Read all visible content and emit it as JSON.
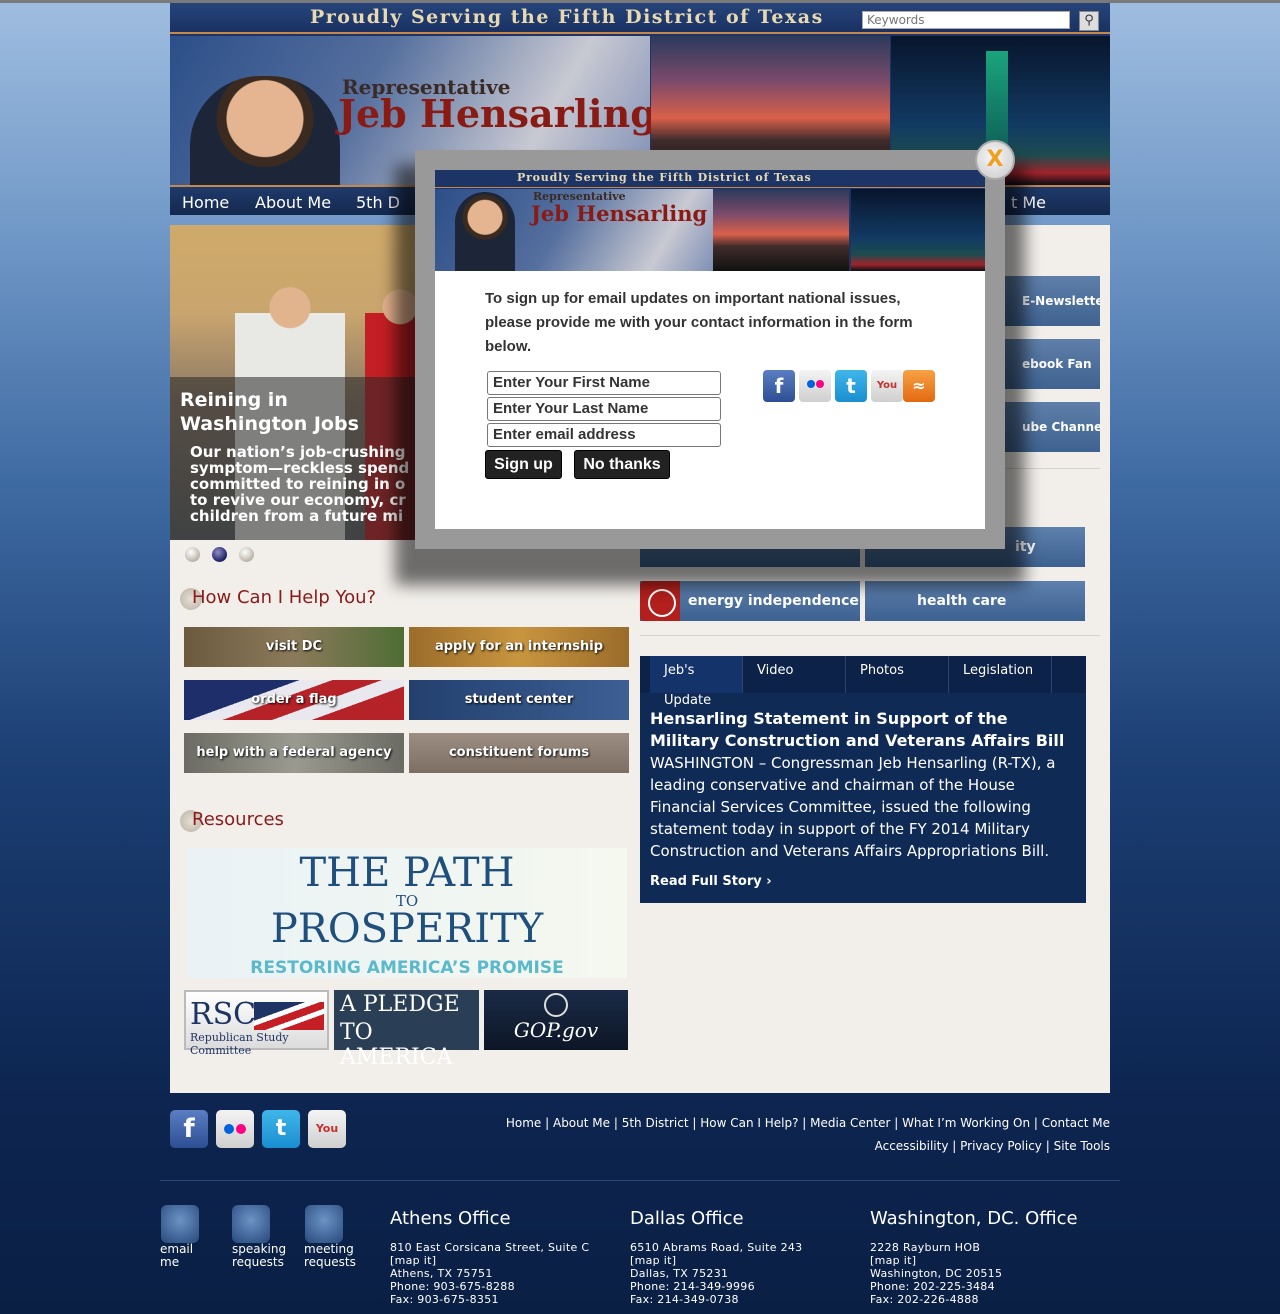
{
  "header": {
    "tagline": "Proudly Serving the Fifth District of Texas",
    "rep_small": "Representative",
    "rep_name": "Jeb Hensarling",
    "search_placeholder": "Keywords"
  },
  "nav": {
    "items": [
      "Home",
      "About Me",
      "5th D",
      "t Me"
    ]
  },
  "slider": {
    "title": "Reining in Washington Jobs",
    "text": [
      "Our nation’s job-crushing",
      "symptom—reckless spend",
      "committed to reining in o",
      "to revive our economy, cr",
      "children from a future mi"
    ],
    "active_dot": 2
  },
  "help": {
    "heading": "How Can I Help You?",
    "buttons": [
      "visit DC",
      "apply for an internship",
      "order a flag",
      "student center",
      "help with a federal agency",
      "constituent forums"
    ]
  },
  "resources": {
    "heading": "Resources",
    "banner": [
      "THE PATH",
      "TO",
      "PROSPERITY",
      "RESTORING AMERICA’S PROMISE"
    ],
    "rsc": [
      "RSC",
      "Republican Study Committee"
    ],
    "pledge": [
      "A PLEDGE",
      "TO AMERICA"
    ],
    "gop": "GOP.gov"
  },
  "side_buttons": [
    "E-Newsletter",
    "ebook Fan",
    "ube Channel"
  ],
  "issues": [
    "energy independence",
    "health care",
    "ity"
  ],
  "news": {
    "tabs": [
      "Jeb's Update",
      "Video",
      "Photos",
      "Legislation"
    ],
    "headline": "Hensarling Statement in Support of the Military Construction and Veterans Affairs Bill",
    "body": "WASHINGTON – Congressman Jeb Hensarling (R-TX), a leading conservative and chairman of the House Financial Services Committee, issued the following statement today in support of the FY 2014 Military Construction and Veterans Affairs Appropriations Bill.",
    "more": "Read Full Story ›"
  },
  "footer": {
    "links_row1": [
      "Home",
      "About Me",
      "5th District",
      "How Can I Help?",
      "Media Center",
      "What I’m Working On",
      "Contact Me"
    ],
    "links_row2": [
      "Accessibility",
      "Privacy Policy",
      "Site Tools"
    ],
    "quick": [
      {
        "label1": "email",
        "label2": "me"
      },
      {
        "label1": "speaking",
        "label2": "requests"
      },
      {
        "label1": "meeting",
        "label2": "requests"
      }
    ],
    "offices": [
      {
        "name": "Athens Office",
        "lines": [
          "810 East Corsicana Street, Suite C",
          "[map it]",
          "Athens, TX 75751",
          "Phone: 903-675-8288",
          "Fax: 903-675-8351"
        ]
      },
      {
        "name": "Dallas Office",
        "lines": [
          "6510 Abrams Road, Suite 243",
          "[map it]",
          "Dallas, TX 75231",
          "Phone: 214-349-9996",
          "Fax: 214-349-0738"
        ]
      },
      {
        "name": "Washington, DC. Office",
        "lines": [
          "2228 Rayburn HOB",
          "[map it]",
          "Washington, DC 20515",
          "Phone: 202-225-3484",
          "Fax: 202-226-4888"
        ]
      }
    ]
  },
  "modal": {
    "tagline": "Proudly Serving the Fifth District of Texas",
    "rep_small": "Representative",
    "rep_name": "Jeb Hensarling",
    "message": "To sign up for email updates on important national issues, please provide me with your contact information in the form below.",
    "first_name_placeholder": "Enter Your First Name",
    "last_name_placeholder": "Enter Your Last Name",
    "email_placeholder": "Enter email address",
    "signup_label": "Sign up",
    "nothanks_label": "No thanks",
    "close_label": "X"
  },
  "colors": {
    "accent_red": "#8a1a1a",
    "nav_blue": "#1f3a6a",
    "news_bg": "#0f2a55",
    "close_x": "#f0a020"
  }
}
